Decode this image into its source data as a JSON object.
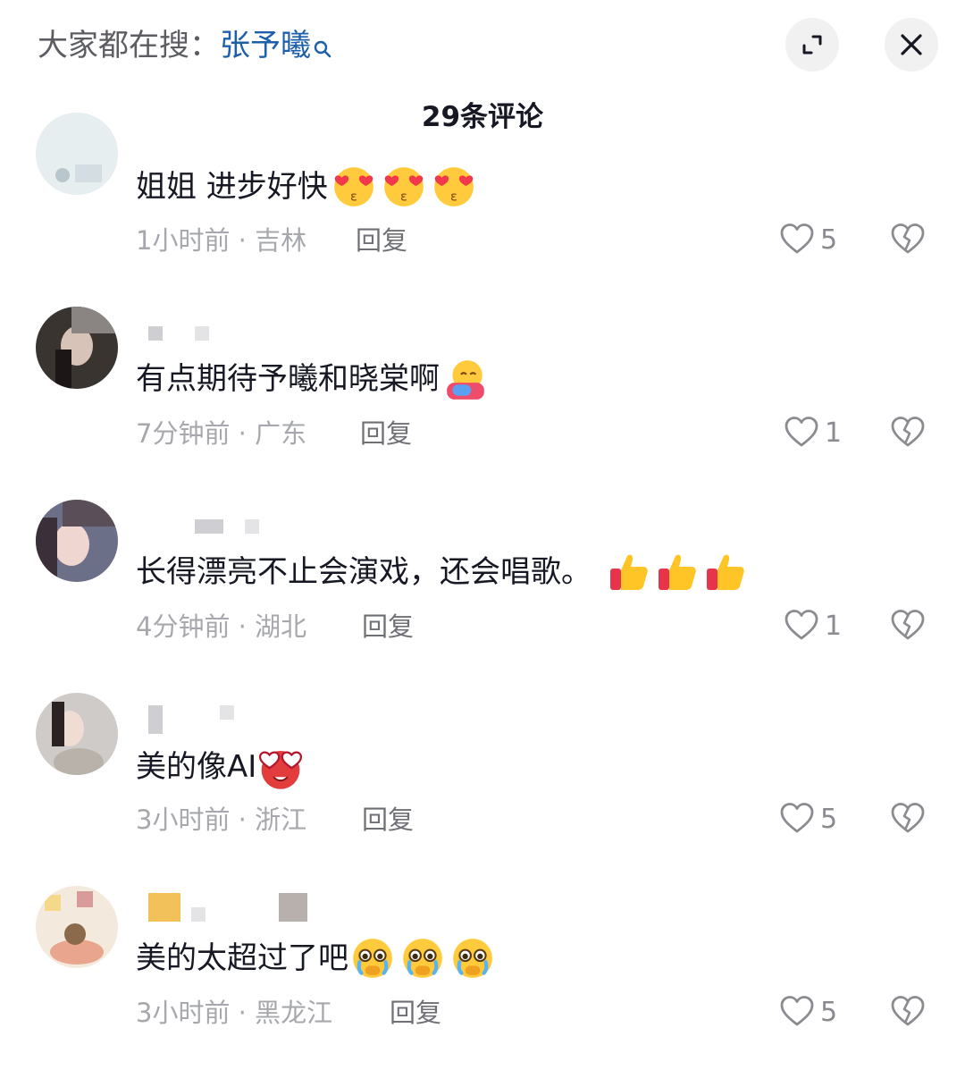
{
  "header": {
    "search_prefix": "大家都在搜：",
    "search_term": "张予曦",
    "comment_count": "29条评论"
  },
  "comments": [
    {
      "text": "姐姐 进步好快",
      "emoji": [
        "kissing-heart-emoji",
        "kissing-heart-emoji",
        "kissing-heart-emoji"
      ],
      "time": "1小时前",
      "location": "吉林",
      "reply": "回复",
      "likes": "5"
    },
    {
      "text": "有点期待予曦和晓棠啊",
      "emoji": [
        "hugging-emoji"
      ],
      "time": "7分钟前",
      "location": "广东",
      "reply": "回复",
      "likes": "1"
    },
    {
      "text": "长得漂亮不止会演戏，还会唱歌。",
      "emoji": [
        "thumbs-up-emoji",
        "thumbs-up-emoji",
        "thumbs-up-emoji"
      ],
      "time": "4分钟前",
      "location": "湖北",
      "reply": "回复",
      "likes": "1"
    },
    {
      "text": "美的像AI",
      "emoji": [
        "heart-eyes-emoji"
      ],
      "time": "3小时前",
      "location": "浙江",
      "reply": "回复",
      "likes": "5"
    },
    {
      "text": "美的太超过了吧",
      "emoji": [
        "pleading-tears-emoji",
        "pleading-tears-emoji",
        "pleading-tears-emoji"
      ],
      "time": "3小时前",
      "location": "黑龙江",
      "reply": "回复",
      "likes": "5"
    }
  ],
  "meta_separator": " · ",
  "colors": {
    "search_term": "#1d5fa8",
    "meta_text": "#a7a8ad",
    "icon_gray": "#8a8b90"
  }
}
